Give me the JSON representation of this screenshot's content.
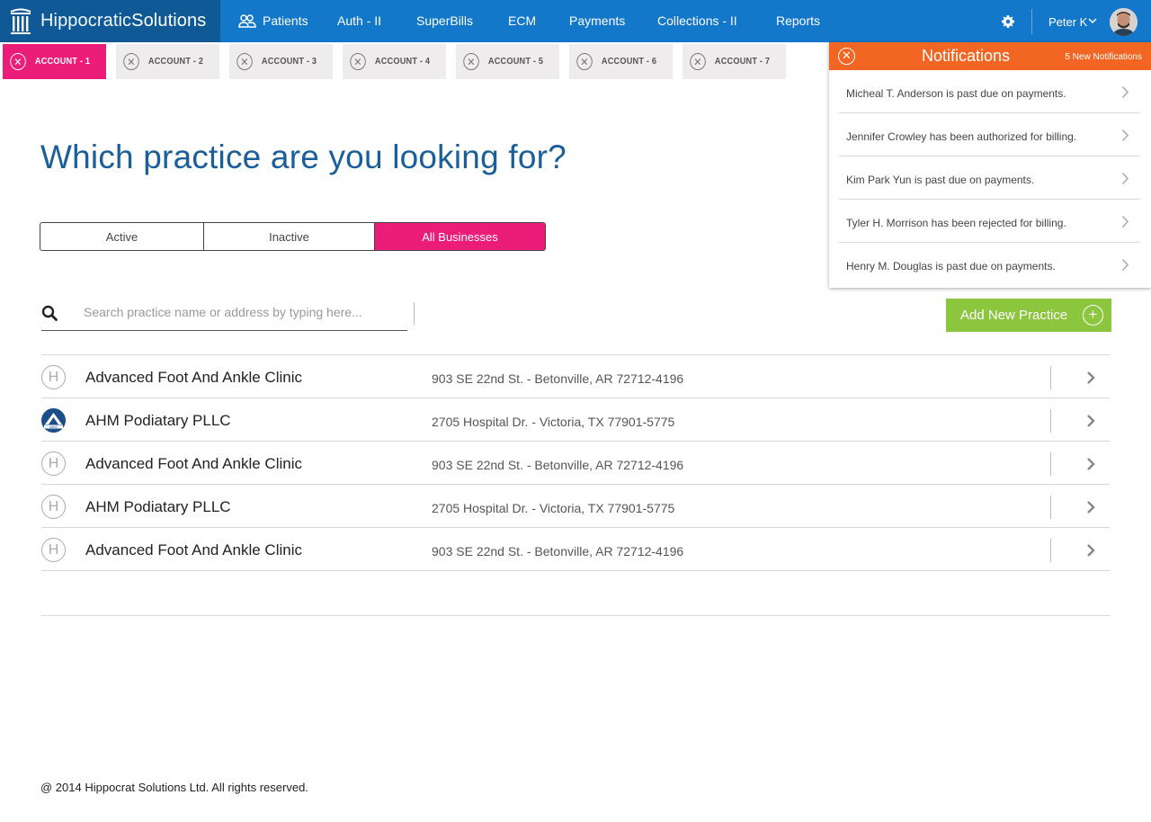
{
  "brand": {
    "name_light": "Hippocratic",
    "name_bold": "Solutions"
  },
  "nav": {
    "items": [
      {
        "label": "Patients"
      },
      {
        "label": "Auth - II"
      },
      {
        "label": "SuperBills"
      },
      {
        "label": "ECM"
      },
      {
        "label": "Payments"
      },
      {
        "label": "Collections - II"
      },
      {
        "label": "Reports"
      }
    ],
    "user": {
      "name": "Peter K"
    }
  },
  "tabs": [
    {
      "label": "ACCOUNT - 1",
      "active": true
    },
    {
      "label": "ACCOUNT - 2"
    },
    {
      "label": "ACCOUNT - 3"
    },
    {
      "label": "ACCOUNT - 4"
    },
    {
      "label": "ACCOUNT - 5"
    },
    {
      "label": "ACCOUNT - 6"
    },
    {
      "label": "ACCOUNT - 7"
    }
  ],
  "main": {
    "heading": "Which practice are you looking for?",
    "filters": [
      {
        "label": "Active"
      },
      {
        "label": "Inactive"
      },
      {
        "label": "All Businesses",
        "selected": true
      }
    ],
    "search": {
      "placeholder": "Search practice name or address by typing here..."
    },
    "add_button": "Add New Practice",
    "practices": [
      {
        "logo": "H",
        "name": "Advanced Foot And Ankle Clinic",
        "address": "903 SE 22nd St. - Betonville, AR 72712-4196"
      },
      {
        "logo": "VANC",
        "name": "AHM Podiatary PLLC",
        "address": "2705 Hospital Dr. - Victoria, TX 77901-5775"
      },
      {
        "logo": "H",
        "name": "Advanced Foot And Ankle Clinic",
        "address": "903 SE 22nd St. - Betonville, AR 72712-4196"
      },
      {
        "logo": "H",
        "name": "AHM Podiatary PLLC",
        "address": "2705 Hospital Dr. - Victoria, TX 77901-5775"
      },
      {
        "logo": "H",
        "name": "Advanced Foot And Ankle Clinic",
        "address": "903 SE 22nd St. - Betonville, AR 72712-4196"
      }
    ]
  },
  "notifications": {
    "title": "Notifications",
    "count_label": "5 New Notifications",
    "items": [
      "Micheal T. Anderson is past due on payments.",
      "Jennifer Crowley has been authorized for billing.",
      "Kim Park Yun is past due on payments.",
      "Tyler H. Morrison has been rejected for billing.",
      "Henry M. Douglas is past due on payments."
    ]
  },
  "footer": {
    "copyright": "@ 2014 Hippocrat Solutions Ltd. All rights reserved."
  },
  "colors": {
    "nav": "#1378c9",
    "brand_bg": "#0f5a96",
    "accent": "#ec1d79",
    "add": "#8cc63f",
    "notif": "#f26522",
    "heading": "#1a5f9b"
  }
}
